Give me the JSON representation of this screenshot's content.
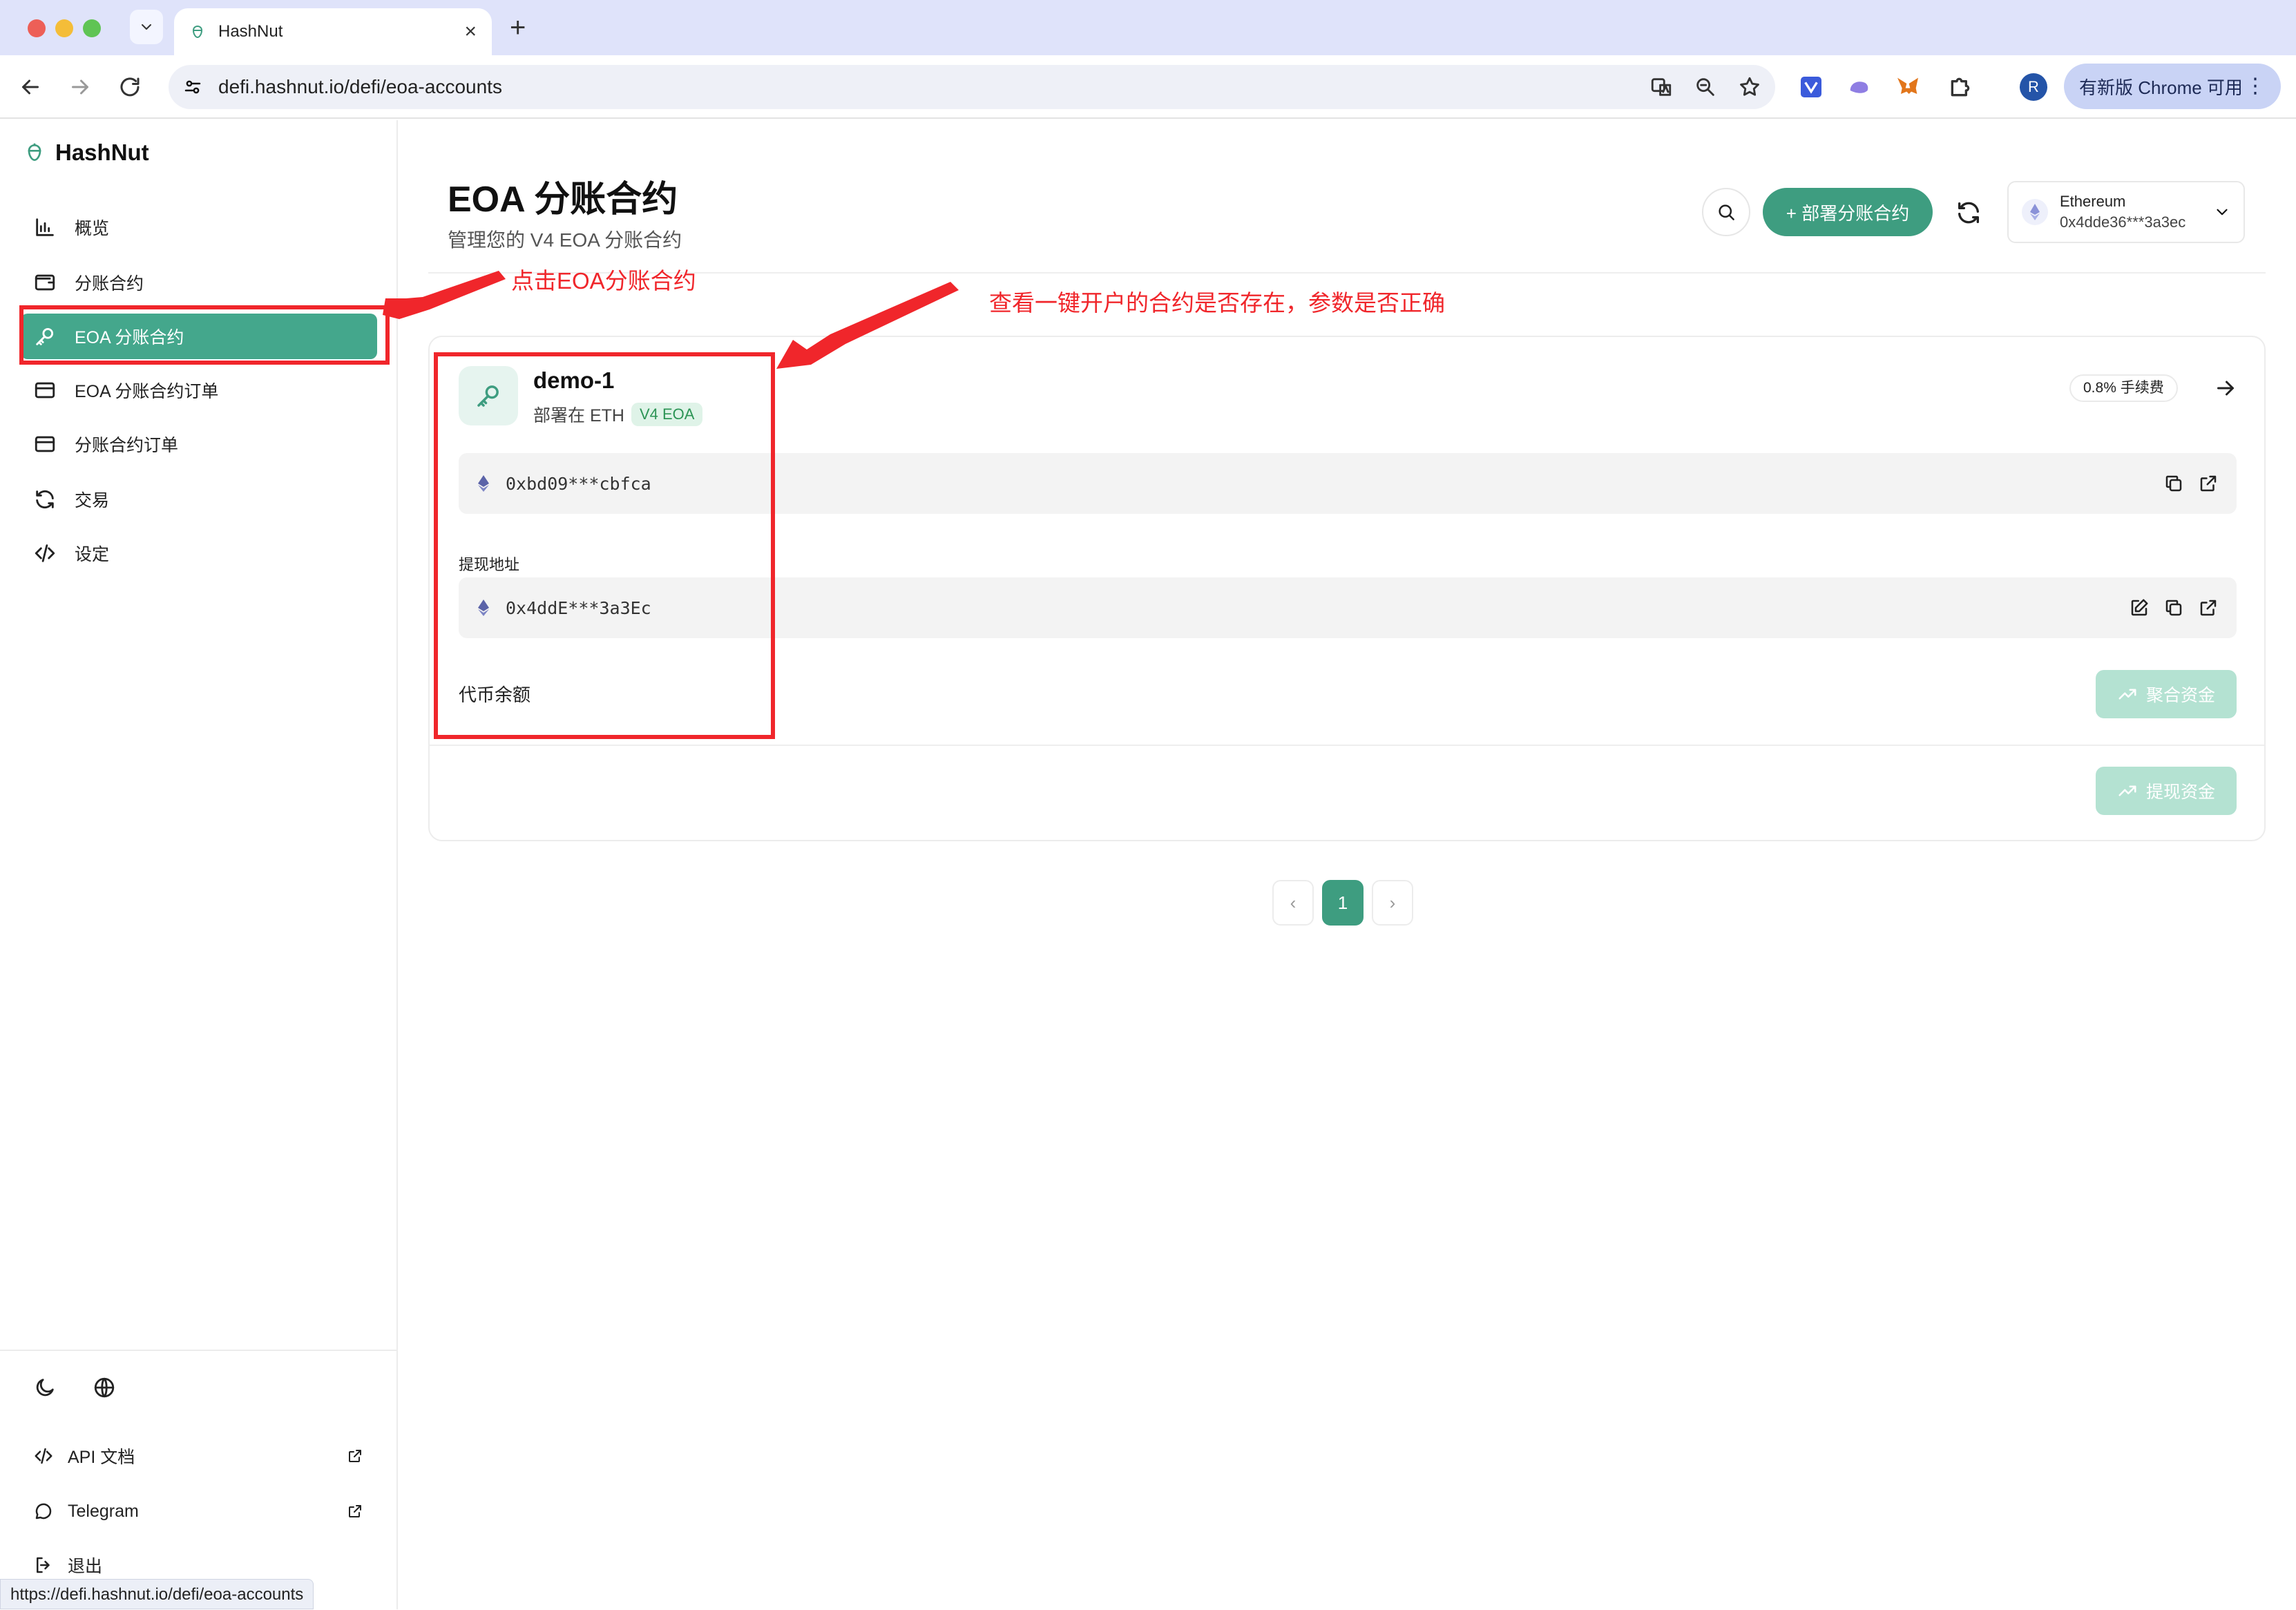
{
  "browser": {
    "tab_title": "HashNut",
    "url": "defi.hashnut.io/defi/eoa-accounts",
    "update_label": "有新版 Chrome 可用",
    "profile_initial": "R",
    "status_url": "https://defi.hashnut.io/defi/eoa-accounts"
  },
  "sidebar": {
    "brand": "HashNut",
    "items": [
      {
        "label": "概览",
        "icon": "bar-chart-icon"
      },
      {
        "label": "分账合约",
        "icon": "wallet-icon"
      },
      {
        "label": "EOA 分账合约",
        "icon": "key-icon",
        "active": true
      },
      {
        "label": "EOA 分账合约订单",
        "icon": "card-icon"
      },
      {
        "label": "分账合约订单",
        "icon": "card-icon"
      },
      {
        "label": "交易",
        "icon": "refresh-icon"
      },
      {
        "label": "设定",
        "icon": "code-icon"
      }
    ],
    "footer": [
      {
        "label": "API 文档",
        "icon": "code-icon"
      },
      {
        "label": "Telegram",
        "icon": "chat-icon"
      },
      {
        "label": "退出",
        "icon": "logout-icon"
      }
    ]
  },
  "header": {
    "title": "EOA 分账合约",
    "subtitle": "管理您的 V4 EOA 分账合约",
    "deploy_label": "+ 部署分账合约",
    "network": "Ethereum",
    "wallet_address": "0x4dde36***3a3ec"
  },
  "card": {
    "name": "demo-1",
    "deployed_on": "部署在 ETH",
    "version": "V4 EOA",
    "fee": "0.8% 手续费",
    "contract_address": "0xbd09***cbfca",
    "withdraw_label": "提现地址",
    "withdraw_address": "0x4ddE***3a3Ec",
    "balance_label": "代币余额",
    "aggregate_label": "聚合资金",
    "withdraw_funds_label": "提现资金"
  },
  "pagination": {
    "current": "1",
    "prev": "‹",
    "next": "›"
  },
  "annotations": {
    "click_hint": "点击EOA分账合约",
    "check_hint": "查看一键开户的合约是否存在，参数是否正确",
    "color": "#f0262b"
  },
  "colors": {
    "accent": "#3e9d80",
    "accent_light": "#b4e2d2"
  }
}
